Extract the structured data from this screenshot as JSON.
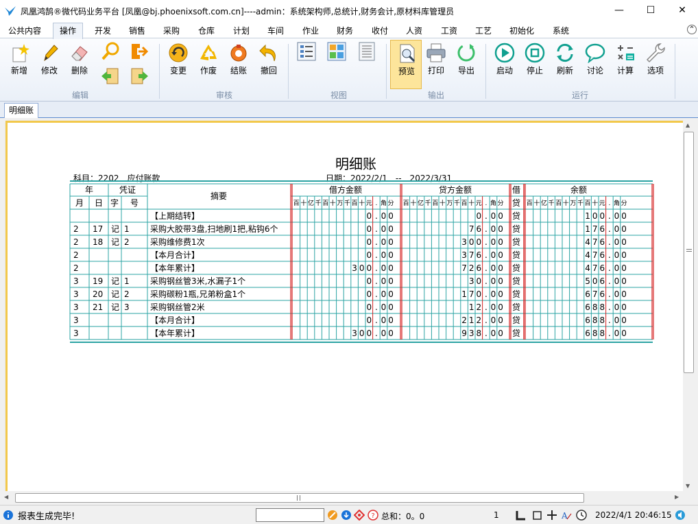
{
  "window": {
    "title": "凤凰鸿鹄®微代码业务平台  [凤凰@bj.phoenixsoft.com.cn]----admin：系统架构师,总统计,财务会计,原材料库管理员",
    "minimize": "—",
    "maximize": "☐",
    "close": "✕"
  },
  "menu": {
    "tabs": [
      "公共内容",
      "操作",
      "开发",
      "销售",
      "采购",
      "仓库",
      "计划",
      "车间",
      "作业",
      "财务",
      "收付",
      "人资",
      "工资",
      "工艺",
      "初始化",
      "系统"
    ],
    "active": "操作",
    "collapse": "⌃"
  },
  "ribbon": {
    "groups": [
      "编辑",
      "审核",
      "视图",
      "输出",
      "运行"
    ],
    "edit": {
      "add": "新增",
      "modify": "修改",
      "delete": "删除"
    },
    "audit": {
      "change": "变更",
      "void": "作废",
      "close_account": "结账",
      "withdraw": "撤回"
    },
    "output": {
      "preview": "预览",
      "print": "打印",
      "export": "导出"
    },
    "run": {
      "start": "启动",
      "stop": "停止",
      "refresh": "刷新",
      "discuss": "讨论",
      "calculate": "计算",
      "options": "选项"
    }
  },
  "doc_tab": "明细账",
  "report": {
    "title": "明细账",
    "subject_label": "科目：2202　应付账款",
    "date_label": "日期：2022/2/1　--　2022/3/31",
    "headers": {
      "year": "年",
      "voucher": "凭证",
      "summary": "摘要",
      "debit": "借方金额",
      "credit": "贷方金额",
      "dc_1": "借",
      "dc_2": "贷",
      "balance": "余额",
      "month": "月",
      "day": "日",
      "word": "字",
      "number": "号"
    },
    "digit_labels": [
      "百",
      "十",
      "亿",
      "千",
      "百",
      "十",
      "万",
      "千",
      "百",
      "十",
      "元",
      ".",
      "角",
      "分"
    ],
    "rows": [
      {
        "m": "",
        "d": "",
        "w": "",
        "n": "",
        "summary": "【上期结转】",
        "debit": "0.00",
        "credit": "0.00",
        "dc": "贷",
        "balance": "100.00"
      },
      {
        "m": "2",
        "d": "17",
        "w": "记",
        "n": "1",
        "summary": "采购大胶带3盘,扫地刷1把,粘钩6个",
        "debit": "0.00",
        "credit": "76.00",
        "dc": "贷",
        "balance": "176.00"
      },
      {
        "m": "2",
        "d": "18",
        "w": "记",
        "n": "2",
        "summary": "采购维修费1次",
        "debit": "0.00",
        "credit": "300.00",
        "dc": "贷",
        "balance": "476.00"
      },
      {
        "m": "2",
        "d": "",
        "w": "",
        "n": "",
        "summary": "【本月合计】",
        "debit": "0.00",
        "credit": "376.00",
        "dc": "贷",
        "balance": "476.00"
      },
      {
        "m": "2",
        "d": "",
        "w": "",
        "n": "",
        "summary": "【本年累计】",
        "debit": "300.00",
        "credit": "726.00",
        "dc": "贷",
        "balance": "476.00"
      },
      {
        "m": "3",
        "d": "19",
        "w": "记",
        "n": "1",
        "summary": "采购钢丝管3米,水漏子1个",
        "debit": "0.00",
        "credit": "30.00",
        "dc": "贷",
        "balance": "506.00"
      },
      {
        "m": "3",
        "d": "20",
        "w": "记",
        "n": "2",
        "summary": "采购碳粉1瓶,兄弟粉盒1个",
        "debit": "0.00",
        "credit": "170.00",
        "dc": "贷",
        "balance": "676.00"
      },
      {
        "m": "3",
        "d": "21",
        "w": "记",
        "n": "3",
        "summary": "采购钢丝管2米",
        "debit": "0.00",
        "credit": "12.00",
        "dc": "贷",
        "balance": "688.00"
      },
      {
        "m": "3",
        "d": "",
        "w": "",
        "n": "",
        "summary": "【本月合计】",
        "debit": "0.00",
        "credit": "212.00",
        "dc": "贷",
        "balance": "688.00"
      },
      {
        "m": "3",
        "d": "",
        "w": "",
        "n": "",
        "summary": "【本年累计】",
        "debit": "300.00",
        "credit": "938.00",
        "dc": "贷",
        "balance": "688.00"
      }
    ]
  },
  "status": {
    "message": "报表生成完毕!",
    "sum_label": "总和：0。0",
    "page": "1",
    "datetime": "2022/4/1 20:46:15"
  },
  "colors": {
    "teal_line": "#2aa3a3",
    "red_line": "#d42020",
    "accent_yellow": "#f2c84b",
    "active_button": "#fde59b"
  }
}
